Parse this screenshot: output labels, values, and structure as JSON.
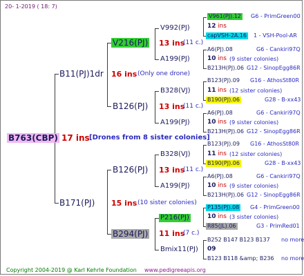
{
  "date_stamp": "20-   1-2019  ( 18:   7)",
  "footer": {
    "copyright": "Copyright 2004-2019 @ Karl Kehrle Foundation",
    "url": "www.pedigreeapis.org"
  },
  "colors": {
    "green_box": "#33cc33",
    "cyan_box": "#00d8e8",
    "yellow_box": "#f5f500",
    "gray_box": "#a8a8a8",
    "root_box": "#f0b8f0",
    "ins": "#cc0000",
    "note": "#2a2abf"
  },
  "root": {
    "name": "B763(CBP)",
    "ins": "17 ins",
    "note": "[Drones from 8 sister colonies]"
  },
  "gen1": {
    "sire": {
      "name": "B11(PJ)1dr",
      "ins": "16 ins",
      "note": "(Only one drone)"
    },
    "dam": {
      "name": "B171(PJ)",
      "ins": "15 ins",
      "note": "(10 sister colonies)"
    }
  },
  "gen2": {
    "a": {
      "name": "V216(PJ)",
      "ins": "13 ins",
      "note": "(11 c.)"
    },
    "b": {
      "name": "B126(PJ)",
      "ins": "13 ins",
      "note": "(11 c.)"
    },
    "c": {
      "name": "B126(PJ)",
      "ins": "13 ins",
      "note": "(11 c.)"
    },
    "d": {
      "name": "B294(PJ)",
      "ins": "11 ins",
      "note": "(7 c.)"
    }
  },
  "gen3": {
    "a1": {
      "name": "V992(PJ)"
    },
    "a2": {
      "name": "A199(PJ)"
    },
    "b1": {
      "name": "B328(VJ)"
    },
    "b2": {
      "name": "A199(PJ)"
    },
    "c1": {
      "name": "B328(VJ)"
    },
    "c2": {
      "name": "A199(PJ)"
    },
    "d1": {
      "name": "P216(PJ)"
    },
    "d2": {
      "name": "Bmix11(PJ)"
    }
  },
  "gen4": [
    {
      "name": "V961(PJ).12",
      "info": "G6 - PrimGreen00"
    },
    {
      "name": "12",
      "ins": "ins"
    },
    {
      "name": "capVSH-2A.16",
      "info": "1 - VSH-Pool-AR"
    },
    {
      "name": "A6(PJ).08",
      "info": "G6 - Cankiri97Q"
    },
    {
      "name": "10",
      "ins": "ins",
      "note": "(9 sister colonies)"
    },
    {
      "name": "B213H(PJ).06",
      "info": "G12 - SinopEgg86R"
    },
    {
      "name": "B123(PJ).09",
      "info": "G16 - AthosSt80R"
    },
    {
      "name": "11",
      "ins": "ins",
      "note": "(12 sister colonies)"
    },
    {
      "name": "B190(PJ).06",
      "info": "G28 - B-xx43"
    },
    {
      "name": "A6(PJ).08",
      "info": "G6 - Cankiri97Q"
    },
    {
      "name": "10",
      "ins": "ins",
      "note": "(9 sister colonies)"
    },
    {
      "name": "B213H(PJ).06",
      "info": "G12 - SinopEgg86R"
    },
    {
      "name": "B123(PJ).09",
      "info": "G16 - AthosSt80R"
    },
    {
      "name": "11",
      "ins": "ins",
      "note": "(12 sister colonies)"
    },
    {
      "name": "B190(PJ).06",
      "info": "G28 - B-xx43"
    },
    {
      "name": "A6(PJ).08",
      "info": "G6 - Cankiri97Q"
    },
    {
      "name": "10",
      "ins": "ins",
      "note": "(9 sister colonies)"
    },
    {
      "name": "B213H(PJ).06",
      "info": "G12 - SinopEgg86R"
    },
    {
      "name": "P135(PJ).08",
      "info": "G4 - PrimGreen00"
    },
    {
      "name": "10",
      "ins": "ins",
      "note": "(3 sister colonies)"
    },
    {
      "name": "R85(JL).06",
      "info": "G3 - PrimRed01"
    },
    {
      "name": "B252 B147 B123 B137",
      "info": "no more"
    },
    {
      "name": "09",
      "ins": ""
    },
    {
      "name": "B123 B118 &amp; B236",
      "info": "no more"
    }
  ]
}
